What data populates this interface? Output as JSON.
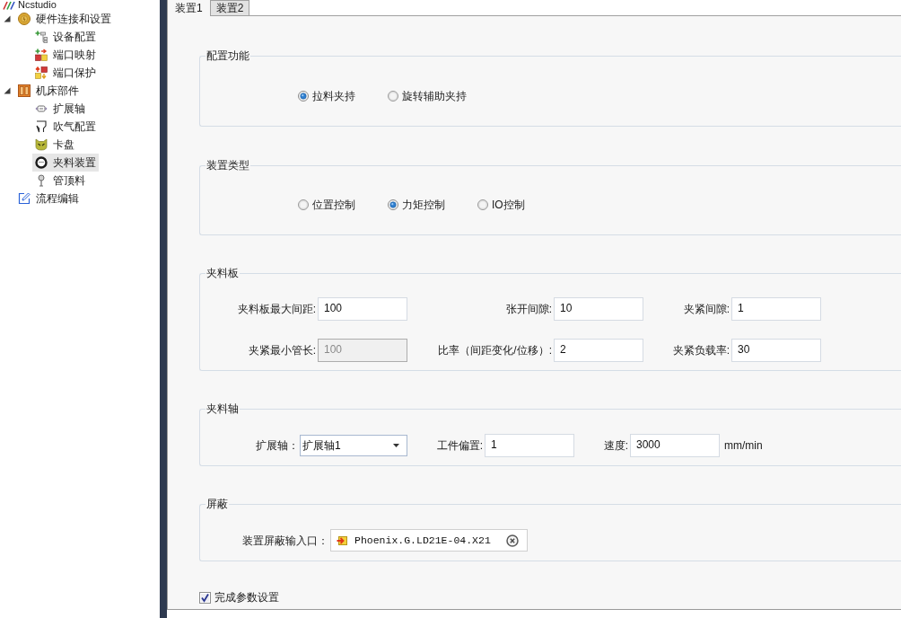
{
  "app": {
    "title": "Ncstudio"
  },
  "tree": [
    {
      "label": "硬件连接和设置",
      "expanded": true,
      "selected": false,
      "children": [
        {
          "label": "设备配置",
          "selected": false
        },
        {
          "label": "端口映射",
          "selected": false
        },
        {
          "label": "端口保护",
          "selected": false
        }
      ]
    },
    {
      "label": "机床部件",
      "expanded": true,
      "selected": false,
      "children": [
        {
          "label": "扩展轴",
          "selected": false
        },
        {
          "label": "吹气配置",
          "selected": false
        },
        {
          "label": "卡盘",
          "selected": false
        },
        {
          "label": "夹料装置",
          "selected": true
        },
        {
          "label": "管顶料",
          "selected": false
        }
      ]
    },
    {
      "label": "流程编辑",
      "selected": false
    }
  ],
  "tabs": [
    {
      "label": "装置1",
      "selected": true
    },
    {
      "label": "装置2",
      "selected": false
    }
  ],
  "function_group": {
    "title": "配置功能",
    "options": [
      {
        "label": "拉料夹持",
        "selected": true
      },
      {
        "label": "旋转辅助夹持",
        "selected": false
      }
    ]
  },
  "type_group": {
    "title": "装置类型",
    "options": [
      {
        "label": "位置控制",
        "selected": false
      },
      {
        "label": "力矩控制",
        "selected": true
      },
      {
        "label": "IO控制",
        "selected": false
      }
    ]
  },
  "plate_group": {
    "title": "夹料板",
    "fields": [
      {
        "label": "夹料板最大间距:",
        "value": "100",
        "disabled": false
      },
      {
        "label": "张开间隙:",
        "value": "10",
        "disabled": false
      },
      {
        "label": "夹紧间隙:",
        "value": "1",
        "disabled": false
      },
      {
        "label": "夹紧最小管长:",
        "value": "100",
        "disabled": true
      },
      {
        "label": "比率（间距变化/位移）:",
        "value": "2",
        "disabled": false
      },
      {
        "label": "夹紧负载率:",
        "value": "30",
        "disabled": false
      }
    ]
  },
  "axis_group": {
    "title": "夹料轴",
    "axis": {
      "label": "扩展轴：",
      "value": "扩展轴1"
    },
    "offset": {
      "label": "工件偏置:",
      "value": "1"
    },
    "speed": {
      "label": "速度:",
      "value": "3000",
      "unit": "mm/min"
    }
  },
  "shield_group": {
    "title": "屏蔽",
    "label": "装置屏蔽输入口：",
    "port": "Phoenix.G.LD21E-04.X21"
  },
  "done_checkbox": {
    "label": "完成参数设置",
    "checked": true
  }
}
